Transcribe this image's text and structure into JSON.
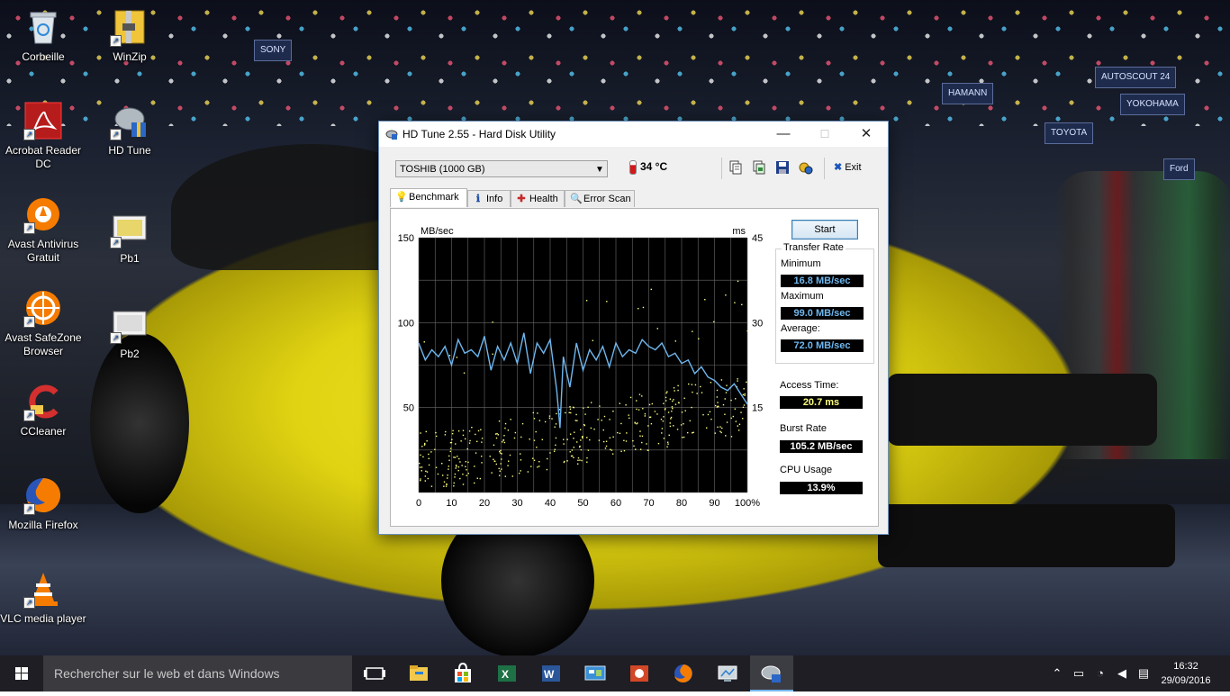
{
  "desktop": {
    "icons": [
      {
        "label": "Corbeille"
      },
      {
        "label": "WinZip"
      },
      {
        "label": "Acrobat Reader DC"
      },
      {
        "label": "HD Tune"
      },
      {
        "label": "Avast Antivirus Gratuit"
      },
      {
        "label": "Pb1"
      },
      {
        "label": "Avast SafeZone Browser"
      },
      {
        "label": "Pb2"
      },
      {
        "label": "CCleaner"
      },
      {
        "label": "Mozilla Firefox"
      },
      {
        "label": "VLC media player"
      }
    ],
    "wallpaper_signs": [
      "SONY",
      "HAMANN",
      "AUTOSCOUT 24",
      "YOKOHAMA",
      "TOYOTA",
      "Ford"
    ]
  },
  "window": {
    "title": "HD Tune 2.55 - Hard Disk Utility",
    "minimize": "—",
    "maximize": "☐",
    "close": "✕",
    "drive": "TOSHIB  (1000 GB)",
    "temperature": "34 °C",
    "exit_label": "Exit",
    "tabs": [
      {
        "label": "Benchmark",
        "icon": "bulb-icon",
        "active": true
      },
      {
        "label": "Info",
        "icon": "info-icon"
      },
      {
        "label": "Health",
        "icon": "health-cross-icon"
      },
      {
        "label": "Error Scan",
        "icon": "magnifier-icon"
      }
    ],
    "start_label": "Start",
    "transfer_rate_title": "Transfer Rate",
    "minimum_label": "Minimum",
    "minimum_value": "16.8 MB/sec",
    "maximum_label": "Maximum",
    "maximum_value": "99.0 MB/sec",
    "average_label": "Average:",
    "average_value": "72.0 MB/sec",
    "access_time_label": "Access Time:",
    "access_time_value": "20.7 ms",
    "burst_rate_label": "Burst Rate",
    "burst_rate_value": "105.2 MB/sec",
    "cpu_usage_label": "CPU Usage",
    "cpu_usage_value": "13.9%",
    "colors": {
      "transfer": "#6fb7ef",
      "access": "#ffff80",
      "burst": "#ffffff",
      "cpu": "#ffffff"
    }
  },
  "chart_data": {
    "type": "line",
    "left_unit": "MB/sec",
    "right_unit": "ms",
    "y_left_ticks": [
      "150",
      "100",
      "50"
    ],
    "y_right_ticks": [
      "45",
      "30",
      "15"
    ],
    "x_ticks": [
      "0",
      "10",
      "20",
      "30",
      "40",
      "50",
      "60",
      "70",
      "80",
      "90",
      "100%"
    ],
    "ylim_left": [
      0,
      150
    ],
    "ylim_right": [
      0,
      45
    ],
    "xlim": [
      0,
      100
    ],
    "grid": true,
    "series": [
      {
        "x": [
          0,
          2,
          4,
          6,
          8,
          10,
          12,
          14,
          16,
          18,
          20,
          22,
          24,
          26,
          28,
          30,
          32,
          34,
          36,
          38,
          40,
          42,
          43,
          44,
          46,
          48,
          50,
          52,
          54,
          56,
          58,
          60,
          62,
          64,
          66,
          68,
          70,
          72,
          74,
          76,
          78,
          80,
          82,
          84,
          86,
          88,
          90,
          92,
          94,
          96,
          98,
          100
        ],
        "values": [
          88,
          78,
          84,
          80,
          86,
          75,
          90,
          82,
          84,
          80,
          92,
          72,
          86,
          78,
          88,
          76,
          94,
          70,
          88,
          82,
          90,
          60,
          38,
          80,
          62,
          88,
          72,
          84,
          78,
          86,
          74,
          88,
          80,
          84,
          82,
          90,
          86,
          84,
          88,
          80,
          82,
          76,
          78,
          70,
          74,
          68,
          66,
          62,
          60,
          64,
          58,
          52
        ]
      }
    ],
    "access_scatter_note": ""
  },
  "taskbar": {
    "search_placeholder": "Rechercher sur le web et dans Windows",
    "apps": [
      "task-view-icon",
      "file-explorer-icon",
      "store-icon",
      "excel-icon",
      "word-icon",
      "control-panel-icon",
      "powerpoint-icon",
      "firefox-icon",
      "system-icon",
      "hdtune-icon"
    ],
    "time": "16:32",
    "date": "29/09/2016"
  }
}
